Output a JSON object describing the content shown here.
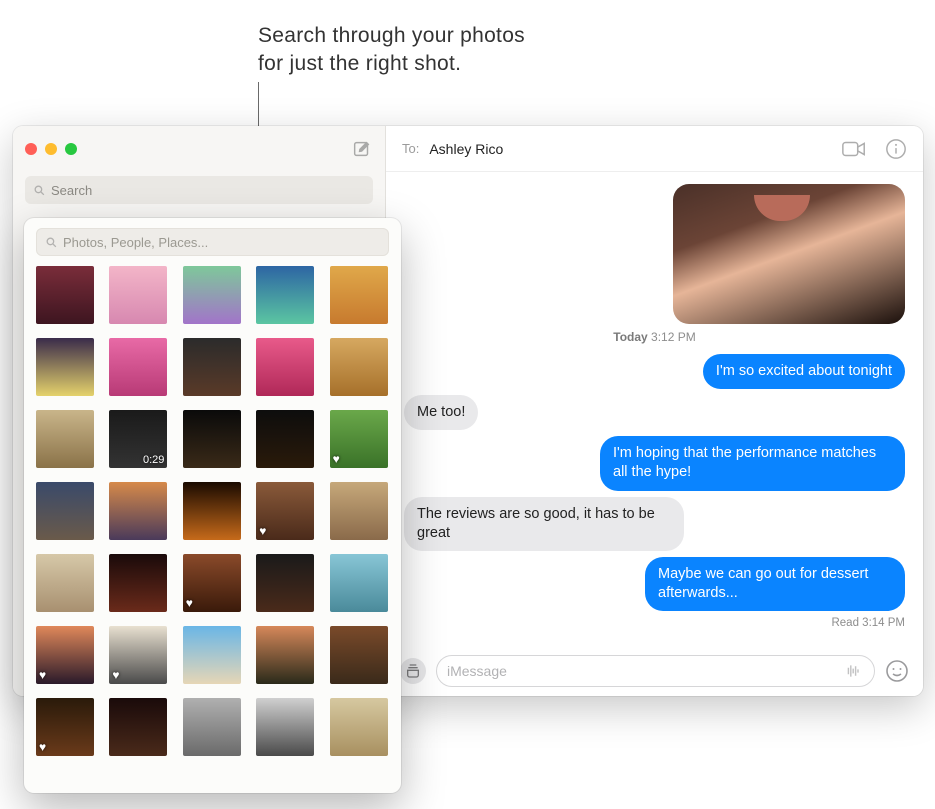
{
  "annotation": {
    "line1": "Search through your photos",
    "line2": "for just the right shot."
  },
  "sidebar": {
    "search_placeholder": "Search"
  },
  "header": {
    "to_label": "To:",
    "to_name": "Ashley Rico"
  },
  "conversation": {
    "timestamp_day": "Today",
    "timestamp_time": "3:12 PM",
    "msg1_sent": "I'm so excited about tonight",
    "msg2_recv": "Me too!",
    "msg3_sent": "I'm hoping that the performance matches all the hype!",
    "msg4_recv": "The reviews are so good, it has to be great",
    "msg5_sent": "Maybe we can go out for dessert afterwards...",
    "read_receipt": "Read 3:14 PM"
  },
  "compose": {
    "placeholder": "iMessage"
  },
  "popover": {
    "search_placeholder": "Photos, People, Places...",
    "thumbs": [
      {
        "bg": "linear-gradient(#7a2d3a,#3d1520)",
        "fav": false
      },
      {
        "bg": "linear-gradient(#f3b5c8,#d788b0)",
        "fav": false
      },
      {
        "bg": "linear-gradient(#7ec89a,#a274c9)",
        "fav": false
      },
      {
        "bg": "linear-gradient(#2d65a3,#5bc6a2)",
        "fav": false
      },
      {
        "bg": "linear-gradient(#e0a84a,#c77a2e)",
        "fav": false
      },
      {
        "bg": "linear-gradient(#3a2b4a,#e5d26b)",
        "fav": false
      },
      {
        "bg": "linear-gradient(#e86aa6,#b83a76)",
        "fav": false
      },
      {
        "bg": "linear-gradient(#2b2b2b,#5a3a28)",
        "fav": false
      },
      {
        "bg": "linear-gradient(#e85a8a,#b02858)",
        "fav": false
      },
      {
        "bg": "linear-gradient(#d6a860,#a6702a)",
        "fav": false
      },
      {
        "bg": "linear-gradient(#c9b58a,#8a7248)",
        "fav": false
      },
      {
        "bg": "linear-gradient(#1a1a1a,#333)",
        "fav": false,
        "duration": "0:29"
      },
      {
        "bg": "linear-gradient(#0a0a0a,#3a2a18)",
        "fav": false
      },
      {
        "bg": "linear-gradient(#0d0d0d,#2a1a0a)",
        "fav": false
      },
      {
        "bg": "linear-gradient(#6aa84a,#3a7228)",
        "fav": true
      },
      {
        "bg": "linear-gradient(#3a4a6a,#6a5a4a)",
        "fav": false
      },
      {
        "bg": "linear-gradient(#d68a4a,#4a3a5a)",
        "fav": false
      },
      {
        "bg": "linear-gradient(#1a0a00,#c66a1a)",
        "fav": false
      },
      {
        "bg": "linear-gradient(#8a5a3a,#4a2a1a)",
        "fav": true
      },
      {
        "bg": "linear-gradient(#c6a87a,#8a6a4a)",
        "fav": false
      },
      {
        "bg": "linear-gradient(#d6c8a8,#a89070)",
        "fav": false
      },
      {
        "bg": "linear-gradient(#1a0a0a,#6a2a1a)",
        "fav": false
      },
      {
        "bg": "linear-gradient(#8a4a2a,#3a1a0a)",
        "fav": true
      },
      {
        "bg": "linear-gradient(#1a1a1a,#4a2a1a)",
        "fav": false
      },
      {
        "bg": "linear-gradient(#88c6d6,#4a8a9a)",
        "fav": false
      },
      {
        "bg": "linear-gradient(#e0885a,#2a1a2a)",
        "fav": true
      },
      {
        "bg": "linear-gradient(#e8e0d0,#4a4a4a)",
        "fav": true
      },
      {
        "bg": "linear-gradient(#6ab6e6,#e6d6b6)",
        "fav": false
      },
      {
        "bg": "linear-gradient(#d6885a,#2a2a1a)",
        "fav": false
      },
      {
        "bg": "linear-gradient(#7a4a2a,#3a2a1a)",
        "fav": false
      },
      {
        "bg": "linear-gradient(#2a1a0a,#6a3a1a)",
        "fav": true
      },
      {
        "bg": "linear-gradient(#1a0a0a,#4a2a1a)",
        "fav": false
      },
      {
        "bg": "linear-gradient(#b0b0b0,#6a6a6a)",
        "fav": false
      },
      {
        "bg": "linear-gradient(#d0d0d0,#4a4a4a)",
        "fav": false
      },
      {
        "bg": "linear-gradient(#d6c8a0,#a89060)",
        "fav": false
      }
    ]
  }
}
